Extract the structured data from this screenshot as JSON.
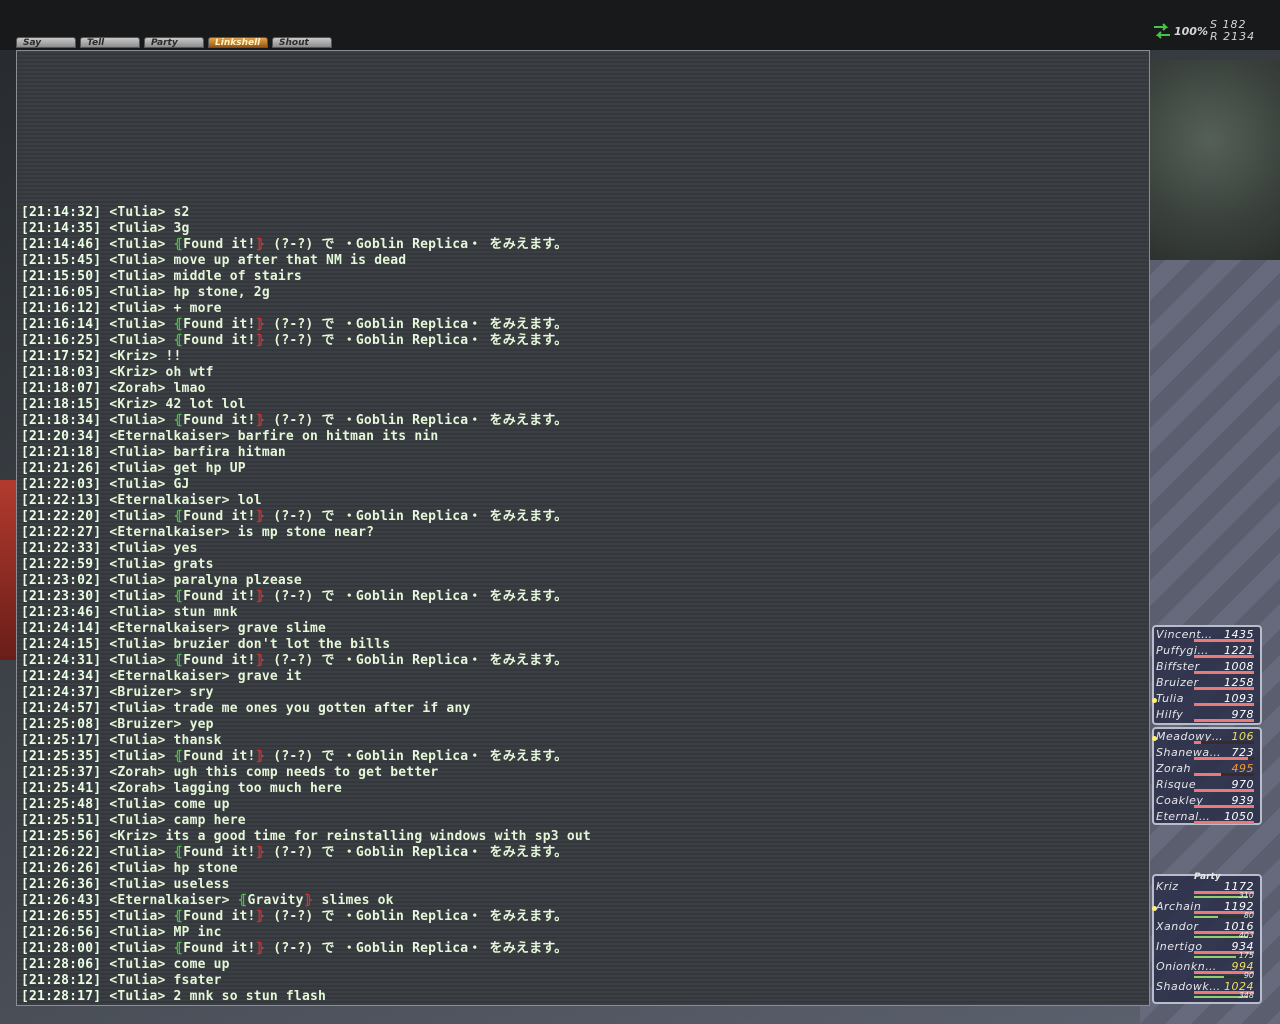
{
  "status": {
    "connection_percent": "100%",
    "server_line": "S 182",
    "rank_line": "R 2134"
  },
  "tabs": [
    "Say",
    "Tell",
    "Party",
    "Linkshell",
    "Shout"
  ],
  "active_tab": "Linkshell",
  "colors": {
    "autotranslate_open": "#47c54a",
    "autotranslate_close": "#d23535",
    "chat_text": "#e4f8d8"
  },
  "chat_log": [
    {
      "t": "[21:14:32]",
      "msg": "<Tulia> s2"
    },
    {
      "t": "[21:14:35]",
      "msg": "<Tulia> 3g"
    },
    {
      "t": "[21:14:46]",
      "pre": "<Tulia> ",
      "at": "Found it!",
      "post": " (?-?) で ・Goblin Replica・ をみえます。"
    },
    {
      "t": "[21:15:45]",
      "msg": "<Tulia> move up after that NM is dead"
    },
    {
      "t": "[21:15:50]",
      "msg": "<Tulia> middle of stairs"
    },
    {
      "t": "[21:16:05]",
      "msg": "<Tulia> hp stone, 2g"
    },
    {
      "t": "[21:16:12]",
      "msg": "<Tulia> + more"
    },
    {
      "t": "[21:16:14]",
      "pre": "<Tulia> ",
      "at": "Found it!",
      "post": " (?-?) で ・Goblin Replica・ をみえます。"
    },
    {
      "t": "[21:16:25]",
      "pre": "<Tulia> ",
      "at": "Found it!",
      "post": " (?-?) で ・Goblin Replica・ をみえます。"
    },
    {
      "t": "[21:17:52]",
      "msg": "<Kriz> !!"
    },
    {
      "t": "[21:18:03]",
      "msg": "<Kriz> oh wtf"
    },
    {
      "t": "[21:18:07]",
      "msg": "<Zorah> lmao"
    },
    {
      "t": "[21:18:15]",
      "msg": "<Kriz> 42 lot lol"
    },
    {
      "t": "[21:18:34]",
      "pre": "<Tulia> ",
      "at": "Found it!",
      "post": " (?-?) で ・Goblin Replica・ をみえます。"
    },
    {
      "t": "[21:20:34]",
      "msg": "<Eternalkaiser> barfire on hitman its nin"
    },
    {
      "t": "[21:21:18]",
      "msg": "<Tulia> barfira hitman"
    },
    {
      "t": "[21:21:26]",
      "msg": "<Tulia> get hp UP"
    },
    {
      "t": "[21:22:03]",
      "msg": "<Tulia> GJ"
    },
    {
      "t": "[21:22:13]",
      "msg": "<Eternalkaiser> lol"
    },
    {
      "t": "[21:22:20]",
      "pre": "<Tulia> ",
      "at": "Found it!",
      "post": " (?-?) で ・Goblin Replica・ をみえます。"
    },
    {
      "t": "[21:22:27]",
      "msg": "<Eternalkaiser> is mp stone near?"
    },
    {
      "t": "[21:22:33]",
      "msg": "<Tulia> yes"
    },
    {
      "t": "[21:22:59]",
      "msg": "<Tulia> grats"
    },
    {
      "t": "[21:23:02]",
      "msg": "<Tulia> paralyna plzease"
    },
    {
      "t": "[21:23:30]",
      "pre": "<Tulia> ",
      "at": "Found it!",
      "post": " (?-?) で ・Goblin Replica・ をみえます。"
    },
    {
      "t": "[21:23:46]",
      "msg": "<Tulia> stun mnk"
    },
    {
      "t": "[21:24:14]",
      "msg": "<Eternalkaiser> grave slime"
    },
    {
      "t": "[21:24:15]",
      "msg": "<Tulia> bruzier don't lot the bills"
    },
    {
      "t": "[21:24:31]",
      "pre": "<Tulia> ",
      "at": "Found it!",
      "post": " (?-?) で ・Goblin Replica・ をみえます。"
    },
    {
      "t": "[21:24:34]",
      "msg": "<Eternalkaiser> grave it"
    },
    {
      "t": "[21:24:37]",
      "msg": "<Bruizer> sry"
    },
    {
      "t": "[21:24:57]",
      "msg": "<Tulia> trade me ones you gotten after if any"
    },
    {
      "t": "[21:25:08]",
      "msg": "<Bruizer> yep"
    },
    {
      "t": "[21:25:17]",
      "msg": "<Tulia> thansk"
    },
    {
      "t": "[21:25:35]",
      "pre": "<Tulia> ",
      "at": "Found it!",
      "post": " (?-?) で ・Goblin Replica・ をみえます。"
    },
    {
      "t": "[21:25:37]",
      "msg": "<Zorah> ugh this comp needs to get better"
    },
    {
      "t": "[21:25:41]",
      "msg": "<Zorah> lagging too much here"
    },
    {
      "t": "[21:25:48]",
      "msg": "<Tulia> come up"
    },
    {
      "t": "[21:25:51]",
      "msg": "<Tulia> camp here"
    },
    {
      "t": "[21:25:56]",
      "msg": "<Kriz> its a good time for reinstalling windows with sp3 out"
    },
    {
      "t": "[21:26:22]",
      "pre": "<Tulia> ",
      "at": "Found it!",
      "post": " (?-?) で ・Goblin Replica・ をみえます。"
    },
    {
      "t": "[21:26:26]",
      "msg": "<Tulia> hp stone"
    },
    {
      "t": "[21:26:36]",
      "msg": "<Tulia> useless"
    },
    {
      "t": "[21:26:43]",
      "pre": "<Eternalkaiser> ",
      "at": "Gravity",
      "post": " slimes ok"
    },
    {
      "t": "[21:26:55]",
      "pre": "<Tulia> ",
      "at": "Found it!",
      "post": " (?-?) で ・Goblin Replica・ をみえます。"
    },
    {
      "t": "[21:26:56]",
      "msg": "<Tulia> MP inc"
    },
    {
      "t": "[21:28:00]",
      "pre": "<Tulia> ",
      "at": "Found it!",
      "post": " (?-?) で ・Goblin Replica・ をみえます。"
    },
    {
      "t": "[21:28:06]",
      "msg": "<Tulia> come up"
    },
    {
      "t": "[21:28:12]",
      "msg": "<Tulia> fsater"
    },
    {
      "t": "[21:28:17]",
      "msg": "<Tulia> 2 mnk so stun flash"
    }
  ],
  "alliance1": [
    {
      "name": "Vincent…",
      "hp": "1435",
      "hpf": 1.0
    },
    {
      "name": "Puffygi…",
      "hp": "1221",
      "hpf": 1.0
    },
    {
      "name": "Biffster",
      "hp": "1008",
      "hpf": 1.0
    },
    {
      "name": "Bruizer",
      "hp": "1258",
      "hpf": 1.0
    },
    {
      "name": "Tulia",
      "hp": "1093",
      "hpf": 1.0,
      "cursor": true
    },
    {
      "name": "Hilfy",
      "hp": "978",
      "hpf": 1.0
    }
  ],
  "alliance2": [
    {
      "name": "Meadowy…",
      "hp": "106",
      "hpf": 0.12,
      "tone": "warn",
      "cursor": true
    },
    {
      "name": "Shanewa…",
      "hp": "723",
      "hpf": 0.9
    },
    {
      "name": "Zorah",
      "hp": "495",
      "hpf": 0.45,
      "tone": "orange"
    },
    {
      "name": "Risque",
      "hp": "970",
      "hpf": 1.0
    },
    {
      "name": "Coakley",
      "hp": "939",
      "hpf": 1.0
    },
    {
      "name": "Eternal…",
      "hp": "1050",
      "hpf": 1.0
    }
  ],
  "party": {
    "label": "Party",
    "members": [
      {
        "name": "Kriz",
        "hp": "1172",
        "hpf": 1.0,
        "mp": "310",
        "mpf": 0.9
      },
      {
        "name": "Archain",
        "hp": "1192",
        "hpf": 1.0,
        "mp": "80",
        "mpf": 0.4,
        "cursor": true
      },
      {
        "name": "Xandor",
        "hp": "1016",
        "hpf": 1.0,
        "mp": "403",
        "mpf": 0.9
      },
      {
        "name": "Inertigo",
        "hp": "934",
        "hpf": 1.0,
        "mp": "175",
        "mpf": 0.7
      },
      {
        "name": "Onionkn…",
        "hp": "994",
        "hpf": 1.0,
        "tone": "warn",
        "mp": "90",
        "mpf": 0.5
      },
      {
        "name": "Shadowk…",
        "hp": "1024",
        "hpf": 1.0,
        "tone": "warn",
        "mp": "348",
        "mpf": 0.9
      }
    ]
  }
}
